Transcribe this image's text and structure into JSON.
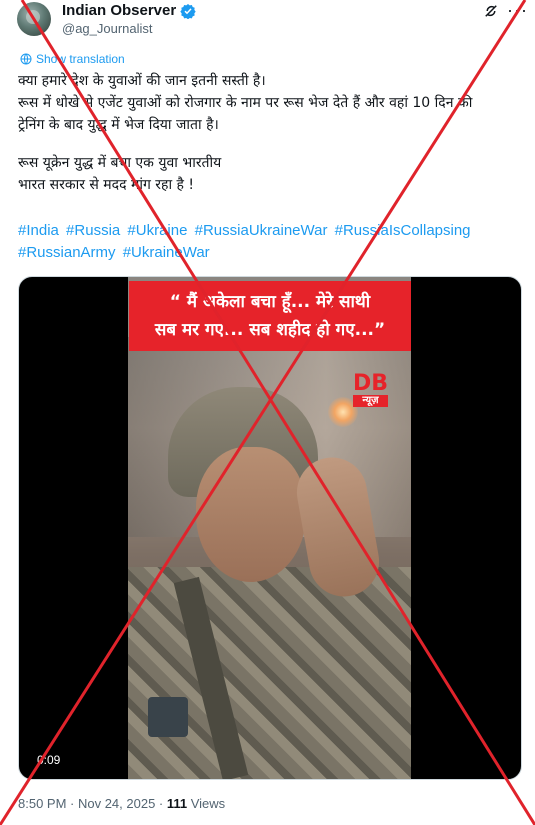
{
  "header": {
    "display_name": "Indian Observer",
    "handle": "@ag_Journalist",
    "verified_icon": "verified-badge-icon",
    "grok_icon": "grok-icon",
    "more_label": "···"
  },
  "translate_label": "Show translation",
  "tweet": {
    "lines": [
      "क्या हमारे देश के युवाओं की जान इतनी सस्ती है।",
      "रूस में धोखे से एजेंट युवाओं को रोजगार के नाम पर रूस भेज देते हैं और वहां 10 दिन की",
      "ट्रेनिंग के बाद युद्ध में भेज दिया जाता है।",
      "रूस यूक्रेन युद्ध में बचा एक युवा भारतीय",
      "भारत सरकार से मदद मांग रहा है !"
    ],
    "hashtags": [
      "#India",
      "#Russia",
      "#Ukraine",
      "#RussiaUkraineWar",
      "#RussiaIsCollapsing",
      "#RussianArmy",
      "#UkraineWar"
    ]
  },
  "video": {
    "banner_line1": "“ मैं अकेला बचा हूँ... मेरे साथी",
    "banner_line2": "सब मर गए... सब शहीद हो गए...”",
    "logo_text": "DB",
    "logo_sub": "न्यूज़",
    "timer": "0:09"
  },
  "meta": {
    "time": "8:50 PM · Nov 24, 2025 · ",
    "views_count": "111",
    "views_label": " Views"
  },
  "overlay": {
    "cross_color": "#e0232b"
  }
}
